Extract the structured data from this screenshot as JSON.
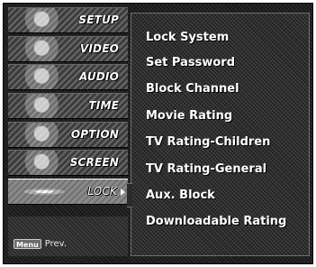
{
  "sidebar": {
    "tabs": [
      {
        "label": "SETUP",
        "icon": "setup-thumb-icon"
      },
      {
        "label": "VIDEO",
        "icon": "video-thumb-icon"
      },
      {
        "label": "AUDIO",
        "icon": "audio-thumb-icon"
      },
      {
        "label": "TIME",
        "icon": "time-thumb-icon"
      },
      {
        "label": "OPTION",
        "icon": "option-thumb-icon"
      },
      {
        "label": "SCREEN",
        "icon": "screen-thumb-icon"
      },
      {
        "label": "LOCK",
        "icon": "lock-thumb-icon",
        "active": true
      }
    ],
    "footer": {
      "menu_key": "Menu",
      "prev_label": "Prev."
    }
  },
  "panel": {
    "options": [
      "Lock System",
      "Set Password",
      "Block Channel",
      "Movie Rating",
      "TV Rating-Children",
      "TV Rating-General",
      "Aux. Block",
      "Downloadable Rating"
    ]
  }
}
